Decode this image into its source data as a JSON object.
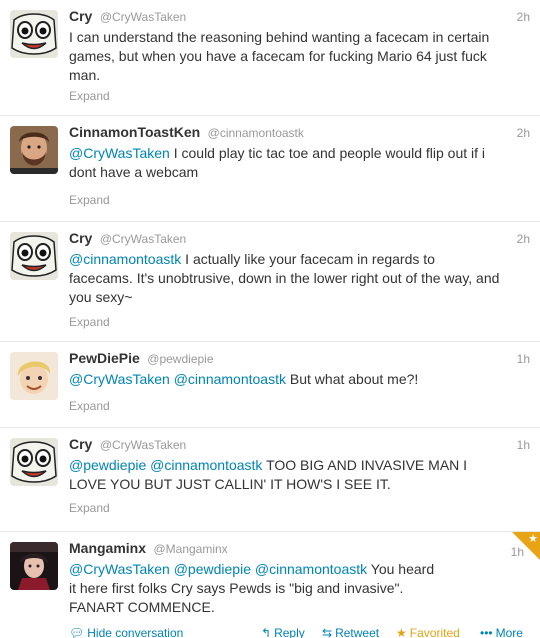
{
  "tweets": [
    {
      "name": "Cry",
      "handle": "@CryWasTaken",
      "time": "2h",
      "lines": [
        [
          {
            "t": "I can understand the reasoning behind wanting a facecam in certain"
          }
        ],
        [
          {
            "t": "games, but when you have a facecam for fucking Mario 64 just fuck"
          }
        ],
        [
          {
            "t": "man."
          }
        ]
      ],
      "expand": "Expand"
    },
    {
      "name": "CinnamonToastKen",
      "handle": "@cinnamontoastk",
      "time": "2h",
      "lines": [
        [
          {
            "t": "@CryWasTaken",
            "m": true
          },
          {
            "t": " I could play tic tac toe and people would flip out if i"
          }
        ],
        [
          {
            "t": "dont have a webcam"
          }
        ]
      ],
      "expand": "Expand"
    },
    {
      "name": "Cry",
      "handle": "@CryWasTaken",
      "time": "2h",
      "lines": [
        [
          {
            "t": "@cinnamontoastk",
            "m": true
          },
          {
            "t": " I actually like your facecam in regards to"
          }
        ],
        [
          {
            "t": "facecams. It's unobtrusive, down in the lower right out of the way, and"
          }
        ],
        [
          {
            "t": "you sexy~"
          }
        ]
      ],
      "expand": "Expand"
    },
    {
      "name": "PewDiePie",
      "handle": "@pewdiepie",
      "time": "1h",
      "lines": [
        [
          {
            "t": "@CryWasTaken",
            "m": true
          },
          {
            "t": " "
          },
          {
            "t": "@cinnamontoastk",
            "m": true
          },
          {
            "t": " But what about me?!"
          }
        ]
      ],
      "expand": "Expand"
    },
    {
      "name": "Cry",
      "handle": "@CryWasTaken",
      "time": "1h",
      "lines": [
        [
          {
            "t": "@pewdiepie",
            "m": true
          },
          {
            "t": " "
          },
          {
            "t": "@cinnamontoastk",
            "m": true
          },
          {
            "t": " TOO BIG AND INVASIVE MAN I"
          }
        ],
        [
          {
            "t": "LOVE YOU BUT JUST CALLIN' IT HOW'S I SEE IT."
          }
        ]
      ],
      "expand": "Expand"
    },
    {
      "name": "Mangaminx",
      "handle": "@Mangaminx",
      "time": "1h",
      "lines": [
        [
          {
            "t": "@CryWasTaken",
            "m": true
          },
          {
            "t": " "
          },
          {
            "t": "@pewdiepie",
            "m": true
          },
          {
            "t": " "
          },
          {
            "t": "@cinnamontoastk",
            "m": true
          },
          {
            "t": " You heard"
          }
        ],
        [
          {
            "t": "it here first folks Cry says Pewds is \"big and invasive\"."
          }
        ],
        [
          {
            "t": "FANART COMMENCE."
          }
        ]
      ]
    }
  ],
  "actions": {
    "hide": "Hide conversation",
    "reply": "Reply",
    "retweet": "Retweet",
    "favorited": "Favorited",
    "more": "More"
  },
  "colors": {
    "link": "#0084b4",
    "muted": "#999999",
    "favorite": "#e0a416"
  }
}
